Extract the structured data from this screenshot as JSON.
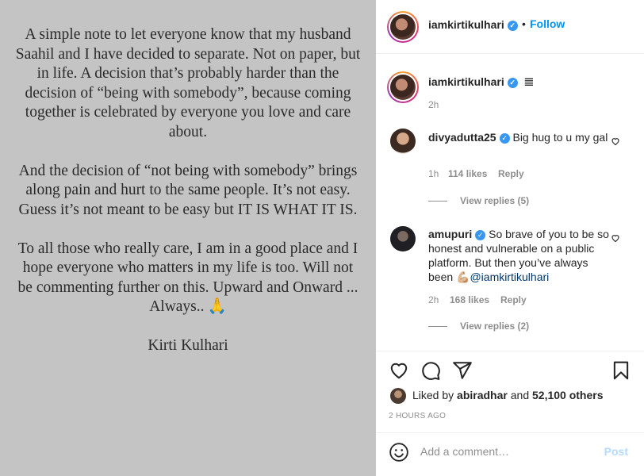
{
  "note": {
    "paragraphs": [
      "A simple note to let everyone know that my husband Saahil and I have decided to separate. Not on paper, but in life.  A decision that’s probably harder than the decision of “being with somebody”,  because coming together is celebrated by everyone you love and care about.",
      "And the decision of “not being with somebody” brings along pain and hurt to the same people. It’s not easy. Guess it’s not meant to be easy but IT IS WHAT IT IS.",
      "To all those who really care, I am in a good place and I hope everyone who matters in my life is too. Will not be commenting further on this. Upward and Onward ... Always.."
    ],
    "pray_emoji": "🙏",
    "signature": "Kirti Kulhari"
  },
  "header": {
    "username": "iamkirtikulhari",
    "verified_mark": "✓",
    "separator": "•",
    "follow_label": "Follow"
  },
  "caption": {
    "username": "iamkirtikulhari",
    "text": "𝌆",
    "time": "2h"
  },
  "comments": [
    {
      "username": "divyadutta25",
      "text": "Big hug to u my gal",
      "time": "1h",
      "likes": "114 likes",
      "reply_label": "Reply",
      "view_replies": "View replies (5)"
    },
    {
      "username": "amupuri",
      "text": "So brave of you to be so honest and vulnerable on a public platform. But then you’ve always been 💪🏼",
      "mention": "@iamkirtikulhari",
      "time": "2h",
      "likes": "168 likes",
      "reply_label": "Reply",
      "view_replies": "View replies (2)"
    }
  ],
  "actions": {
    "icons": [
      "heart-icon",
      "comment-icon",
      "share-icon",
      "bookmark-icon"
    ]
  },
  "likes": {
    "prefix": "Liked by",
    "user": "abiradhar",
    "conj": "and",
    "others": "52,100 others"
  },
  "posted": "2 HOURS AGO",
  "comment_box": {
    "placeholder": "Add a comment…",
    "post_label": "Post",
    "emoji_icon": "smile-icon"
  },
  "colors": {
    "image_bg": "#c4c4c4",
    "accent": "#0095f6",
    "muted": "#8e8e8e",
    "post_disabled": "#b3dbff"
  }
}
